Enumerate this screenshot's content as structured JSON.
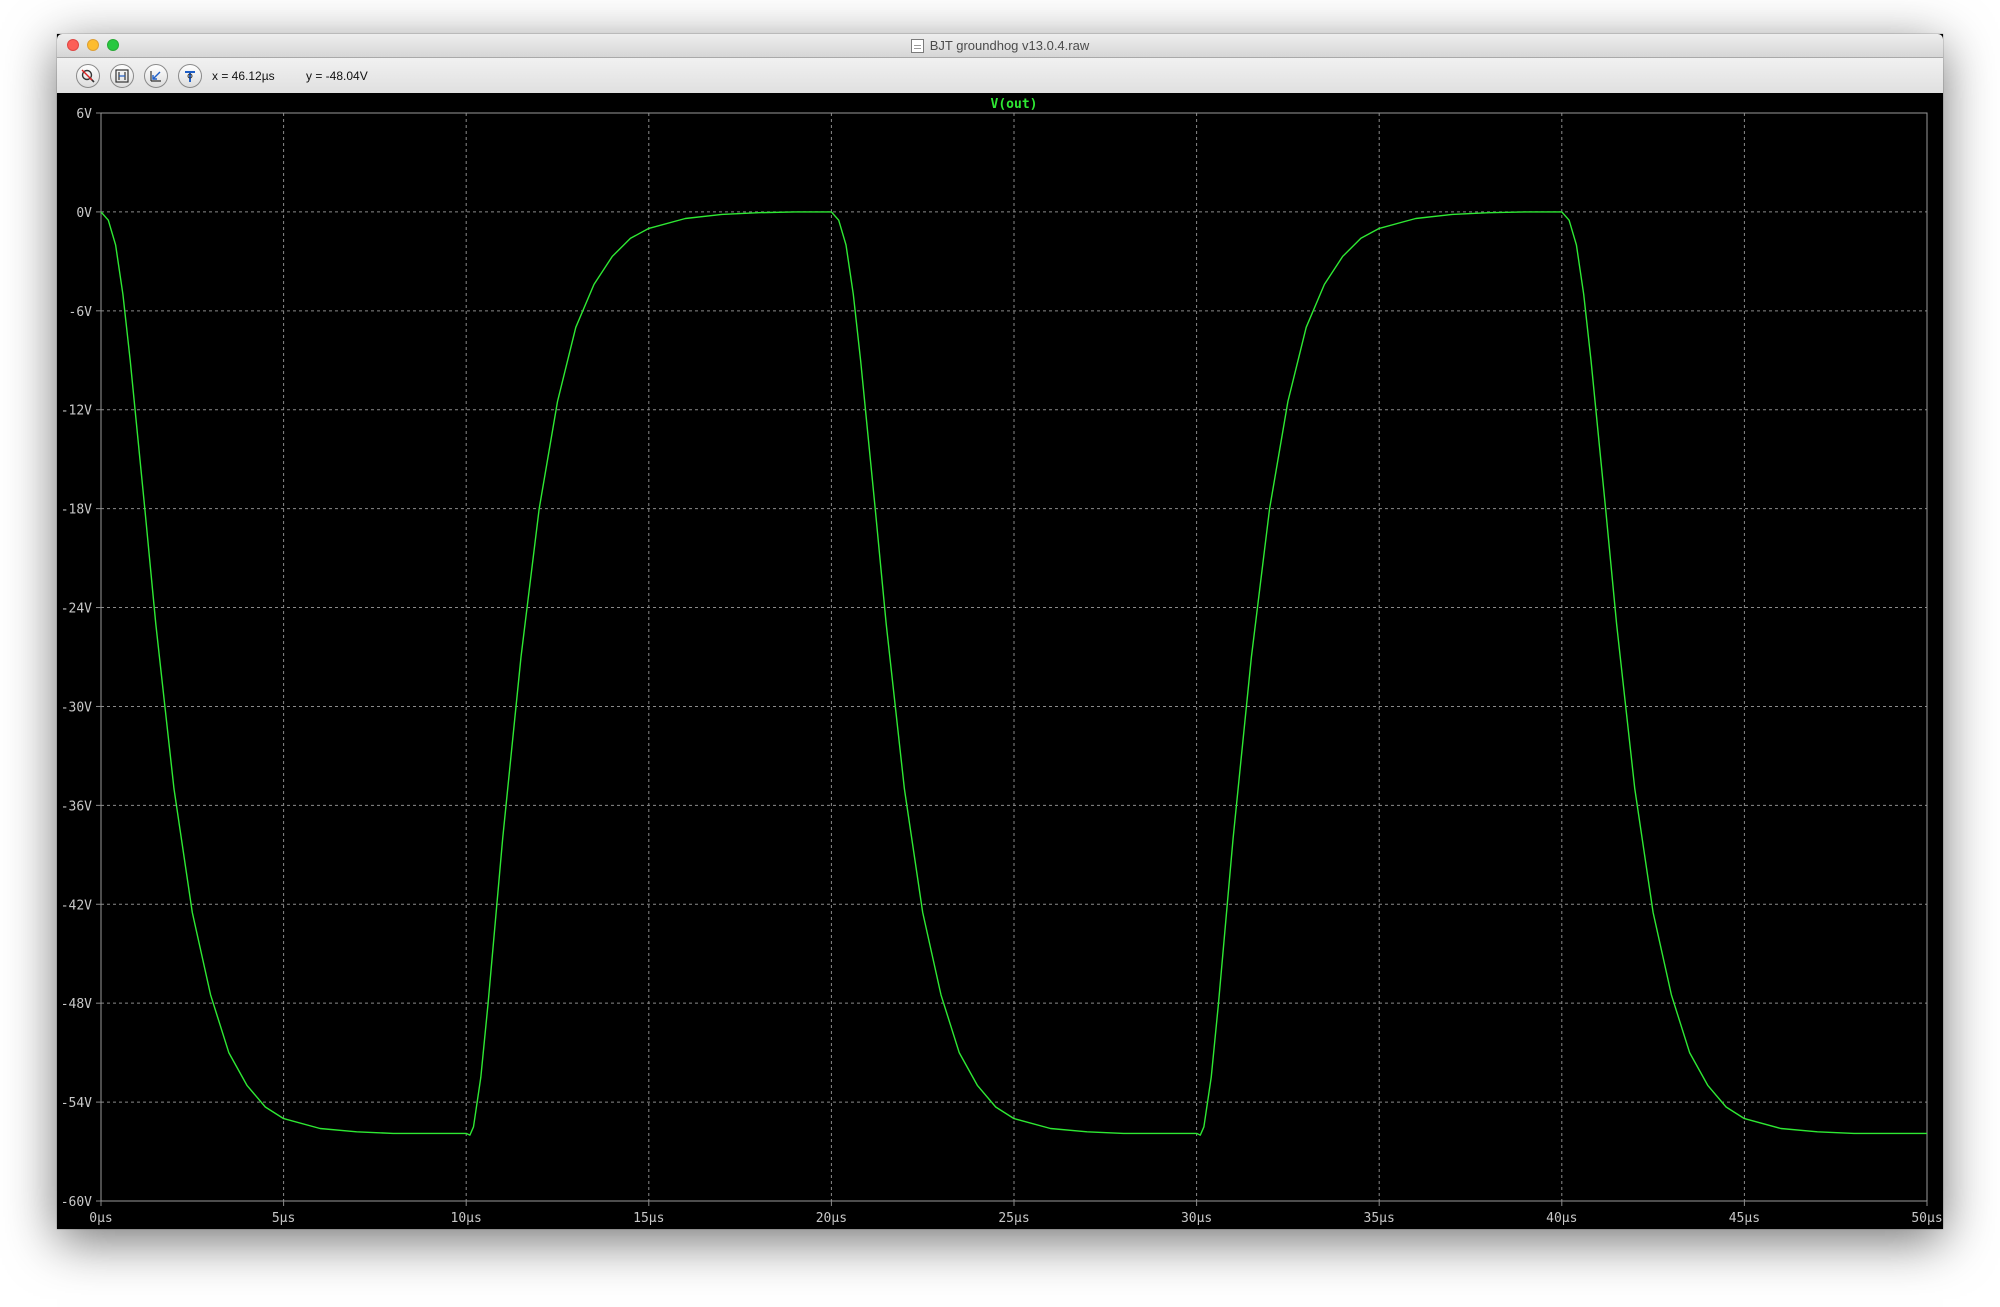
{
  "window": {
    "title": "BJT groundhog v13.0.4.raw"
  },
  "toolbar": {
    "buttons": [
      {
        "name": "zoom-cancel",
        "icon": "magnifier-crossed-icon"
      },
      {
        "name": "zoom-full",
        "icon": "zoom-extents-icon"
      },
      {
        "name": "zoom-back",
        "icon": "zoom-previous-icon"
      },
      {
        "name": "cursor",
        "icon": "probe-cursor-icon"
      }
    ],
    "cursor_x": "x = 46.12µs",
    "cursor_y": "y = -48.04V"
  },
  "colors": {
    "plot_background": "#000000",
    "trace": "#2ee833",
    "grid": "#8a8a8a",
    "axis_text": "#c8c8c8",
    "trace_label": "#2ee833"
  },
  "chart_data": {
    "type": "line",
    "title": "",
    "series": [
      {
        "name": "V(out)",
        "x": [
          0,
          0.2,
          0.4,
          0.6,
          0.8,
          1.0,
          1.2,
          1.5,
          2.0,
          2.5,
          3.0,
          3.5,
          4.0,
          4.5,
          5.0,
          6.0,
          7.0,
          8.0,
          9.0,
          10.0,
          10.1,
          10.2,
          10.4,
          10.6,
          10.8,
          11.0,
          11.5,
          12.0,
          12.5,
          13.0,
          13.5,
          14.0,
          14.5,
          15.0,
          16.0,
          17.0,
          18.0,
          19.0,
          20.0,
          20.2,
          20.4,
          20.6,
          20.8,
          21.0,
          21.2,
          21.5,
          22.0,
          22.5,
          23.0,
          23.5,
          24.0,
          24.5,
          25.0,
          26.0,
          27.0,
          28.0,
          29.0,
          30.0,
          30.1,
          30.2,
          30.4,
          30.6,
          30.8,
          31.0,
          31.5,
          32.0,
          32.5,
          33.0,
          33.5,
          34.0,
          34.5,
          35.0,
          36.0,
          37.0,
          38.0,
          39.0,
          40.0,
          40.2,
          40.4,
          40.6,
          40.8,
          41.0,
          41.2,
          41.5,
          42.0,
          42.5,
          43.0,
          43.5,
          44.0,
          44.5,
          45.0,
          46.0,
          47.0,
          48.0,
          49.0,
          50.0
        ],
        "y": [
          0,
          -0.5,
          -2,
          -5,
          -9,
          -13.5,
          -18,
          -25,
          -35,
          -42.5,
          -47.5,
          -51,
          -53,
          -54.3,
          -55,
          -55.6,
          -55.8,
          -55.9,
          -55.9,
          -55.9,
          -56,
          -55.5,
          -52.5,
          -48,
          -43,
          -38,
          -27,
          -18,
          -11.5,
          -7,
          -4.4,
          -2.7,
          -1.6,
          -1,
          -0.4,
          -0.15,
          -0.05,
          0,
          0,
          -0.5,
          -2,
          -5,
          -9,
          -13.5,
          -18,
          -25,
          -35,
          -42.5,
          -47.5,
          -51,
          -53,
          -54.3,
          -55,
          -55.6,
          -55.8,
          -55.9,
          -55.9,
          -55.9,
          -56,
          -55.5,
          -52.5,
          -48,
          -43,
          -38,
          -27,
          -18,
          -11.5,
          -7,
          -4.4,
          -2.7,
          -1.6,
          -1,
          -0.4,
          -0.15,
          -0.05,
          0,
          0,
          -0.5,
          -2,
          -5,
          -9,
          -13.5,
          -18,
          -25,
          -35,
          -42.5,
          -47.5,
          -51,
          -53,
          -54.3,
          -55,
          -55.6,
          -55.8,
          -55.9,
          -55.9,
          -55.9
        ]
      }
    ],
    "x_ticks": [
      "0µs",
      "5µs",
      "10µs",
      "15µs",
      "20µs",
      "25µs",
      "30µs",
      "35µs",
      "40µs",
      "45µs",
      "50µs"
    ],
    "y_ticks": [
      "6V",
      "0V",
      "-6V",
      "-12V",
      "-18V",
      "-24V",
      "-30V",
      "-36V",
      "-42V",
      "-48V",
      "-54V",
      "-60V"
    ],
    "xlim": [
      0,
      50
    ],
    "ylim": [
      -60,
      6
    ],
    "x_unit": "µs",
    "y_unit": "V",
    "grid": true,
    "legend": "top-center"
  }
}
